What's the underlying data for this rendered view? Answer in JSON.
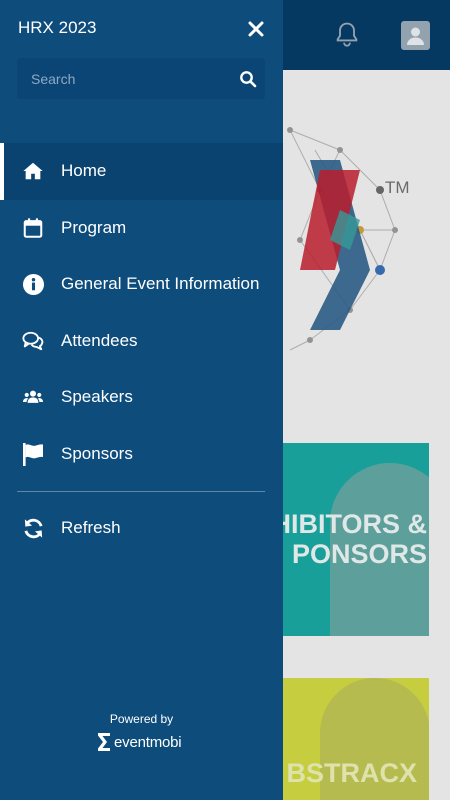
{
  "drawer": {
    "title": "HRX 2023",
    "search_placeholder": "Search",
    "items": [
      {
        "label": "Home",
        "icon": "home-icon",
        "active": true
      },
      {
        "label": "Program",
        "icon": "calendar-icon"
      },
      {
        "label": "General Event Information",
        "icon": "info-icon"
      },
      {
        "label": "Attendees",
        "icon": "chat-bubbles-icon"
      },
      {
        "label": "Speakers",
        "icon": "users-icon"
      },
      {
        "label": "Sponsors",
        "icon": "flag-icon"
      }
    ],
    "refresh_label": "Refresh",
    "powered_by": "Powered by",
    "brand": "eventmobi"
  },
  "background": {
    "logo_tm": "TM",
    "cards": [
      {
        "text_line1": "HIBITORS &",
        "text_line2": "PONSORS"
      },
      {
        "text_line1": "BSTRACX"
      }
    ]
  },
  "colors": {
    "drawer_bg": "#0e4c7c",
    "topbar_bg": "#063c66",
    "teal_card": "#1ba6a0",
    "lime_card": "#cfd642"
  }
}
